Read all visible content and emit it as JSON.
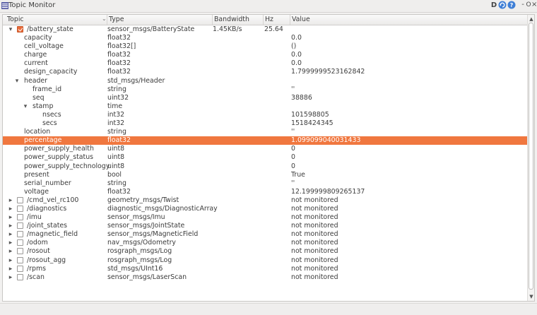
{
  "window": {
    "title": "Topic Monitor",
    "buttons": {
      "d": "D",
      "refresh_icon": "refresh-icon",
      "help_icon": "help-icon",
      "minimize": "-",
      "maximize": "O",
      "close": "×"
    }
  },
  "table": {
    "columns": [
      "Topic",
      "Type",
      "Bandwidth",
      "Hz",
      "Value"
    ],
    "rows": [
      {
        "level": 0,
        "expander": "open",
        "checkbox": "checked",
        "topic": "/battery_state",
        "type": "sensor_msgs/BatteryState",
        "bandwidth": "1.45KB/s",
        "hz": "25.64",
        "value": ""
      },
      {
        "level": 1,
        "topic": "capacity",
        "type": "float32",
        "value": "0.0"
      },
      {
        "level": 1,
        "topic": "cell_voltage",
        "type": "float32[]",
        "value": "()"
      },
      {
        "level": 1,
        "topic": "charge",
        "type": "float32",
        "value": "0.0"
      },
      {
        "level": 1,
        "topic": "current",
        "type": "float32",
        "value": "0.0"
      },
      {
        "level": 1,
        "topic": "design_capacity",
        "type": "float32",
        "value": "1.7999999523162842"
      },
      {
        "level": 1,
        "expander": "open",
        "topic": "header",
        "type": "std_msgs/Header",
        "value": ""
      },
      {
        "level": 2,
        "topic": "frame_id",
        "type": "string",
        "value": "''"
      },
      {
        "level": 2,
        "topic": "seq",
        "type": "uint32",
        "value": "38886"
      },
      {
        "level": 2,
        "expander": "open",
        "topic": "stamp",
        "type": "time",
        "value": ""
      },
      {
        "level": 3,
        "topic": "nsecs",
        "type": "int32",
        "value": "101598805"
      },
      {
        "level": 3,
        "topic": "secs",
        "type": "int32",
        "value": "1518424345"
      },
      {
        "level": 1,
        "topic": "location",
        "type": "string",
        "value": "''"
      },
      {
        "level": 1,
        "topic": "percentage",
        "type": "float32",
        "value": "1.099099040031433",
        "selected": true
      },
      {
        "level": 1,
        "topic": "power_supply_health",
        "type": "uint8",
        "value": "0"
      },
      {
        "level": 1,
        "topic": "power_supply_status",
        "type": "uint8",
        "value": "0"
      },
      {
        "level": 1,
        "topic": "power_supply_technology",
        "type": "uint8",
        "value": "0"
      },
      {
        "level": 1,
        "topic": "present",
        "type": "bool",
        "value": "True"
      },
      {
        "level": 1,
        "topic": "serial_number",
        "type": "string",
        "value": "''"
      },
      {
        "level": 1,
        "topic": "voltage",
        "type": "float32",
        "value": "12.199999809265137"
      },
      {
        "level": 0,
        "expander": "closed",
        "checkbox": "unchecked",
        "topic": "/cmd_vel_rc100",
        "type": "geometry_msgs/Twist",
        "value": "not monitored"
      },
      {
        "level": 0,
        "expander": "closed",
        "checkbox": "unchecked",
        "topic": "/diagnostics",
        "type": "diagnostic_msgs/DiagnosticArray",
        "value": "not monitored"
      },
      {
        "level": 0,
        "expander": "closed",
        "checkbox": "unchecked",
        "topic": "/imu",
        "type": "sensor_msgs/Imu",
        "value": "not monitored"
      },
      {
        "level": 0,
        "expander": "closed",
        "checkbox": "unchecked",
        "topic": "/joint_states",
        "type": "sensor_msgs/JointState",
        "value": "not monitored"
      },
      {
        "level": 0,
        "expander": "closed",
        "checkbox": "unchecked",
        "topic": "/magnetic_field",
        "type": "sensor_msgs/MagneticField",
        "value": "not monitored"
      },
      {
        "level": 0,
        "expander": "closed",
        "checkbox": "unchecked",
        "topic": "/odom",
        "type": "nav_msgs/Odometry",
        "value": "not monitored"
      },
      {
        "level": 0,
        "expander": "closed",
        "checkbox": "unchecked",
        "topic": "/rosout",
        "type": "rosgraph_msgs/Log",
        "value": "not monitored"
      },
      {
        "level": 0,
        "expander": "closed",
        "checkbox": "unchecked",
        "topic": "/rosout_agg",
        "type": "rosgraph_msgs/Log",
        "value": "not monitored"
      },
      {
        "level": 0,
        "expander": "closed",
        "checkbox": "unchecked",
        "topic": "/rpms",
        "type": "std_msgs/UInt16",
        "value": "not monitored"
      },
      {
        "level": 0,
        "expander": "closed",
        "checkbox": "unchecked",
        "topic": "/scan",
        "type": "sensor_msgs/LaserScan",
        "value": "not monitored"
      }
    ]
  },
  "colors": {
    "selection": "#f0773f",
    "checkbox_checked": "#e96b3a"
  }
}
